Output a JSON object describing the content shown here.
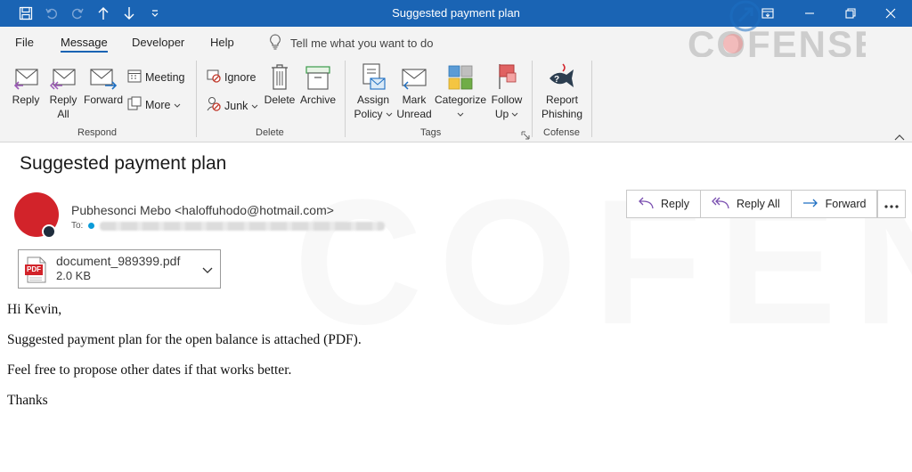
{
  "titlebar": {
    "title": "Suggested payment plan",
    "quick_access": [
      "save-icon",
      "undo-icon",
      "redo-icon",
      "up-arrow-icon",
      "down-arrow-icon",
      "customize-icon"
    ],
    "window_controls": [
      "ribbon-display-icon",
      "minimize-icon",
      "restore-icon",
      "close-icon"
    ],
    "color": "#1a64b4"
  },
  "menu": {
    "tabs": [
      "File",
      "Message",
      "Developer",
      "Help"
    ],
    "active": "Message",
    "tell_me": "Tell me what you want to do"
  },
  "ribbon": {
    "respond": {
      "label": "Respond",
      "reply": "Reply",
      "reply_all_1": "Reply",
      "reply_all_2": "All",
      "forward": "Forward",
      "meeting": "Meeting",
      "more": "More"
    },
    "delete": {
      "label": "Delete",
      "ignore": "Ignore",
      "junk": "Junk",
      "delete": "Delete",
      "archive": "Archive"
    },
    "tags": {
      "label": "Tags",
      "assign_1": "Assign",
      "assign_2": "Policy",
      "mark_1": "Mark",
      "mark_2": "Unread",
      "categorize": "Categorize",
      "follow_1": "Follow",
      "follow_2": "Up"
    },
    "cofense": {
      "label": "Cofense",
      "report_1": "Report",
      "report_2": "Phishing"
    }
  },
  "watermark": {
    "brand": "COFENSE"
  },
  "message": {
    "subject": "Suggested payment plan",
    "sender": "Pubhesonci Mebo <haloffuhodo@hotmail.com>",
    "to_label": "To:",
    "actions": {
      "reply": "Reply",
      "reply_all": "Reply All",
      "forward": "Forward"
    },
    "attachment": {
      "name": "document_989399.pdf",
      "size": "2.0 KB",
      "badge": "PDF"
    },
    "body": [
      "Hi Kevin,",
      "Suggested payment plan for the open balance is attached (PDF).",
      "Feel free to propose other dates if that works better.",
      "Thanks"
    ],
    "avatar_color": "#d2232a"
  }
}
